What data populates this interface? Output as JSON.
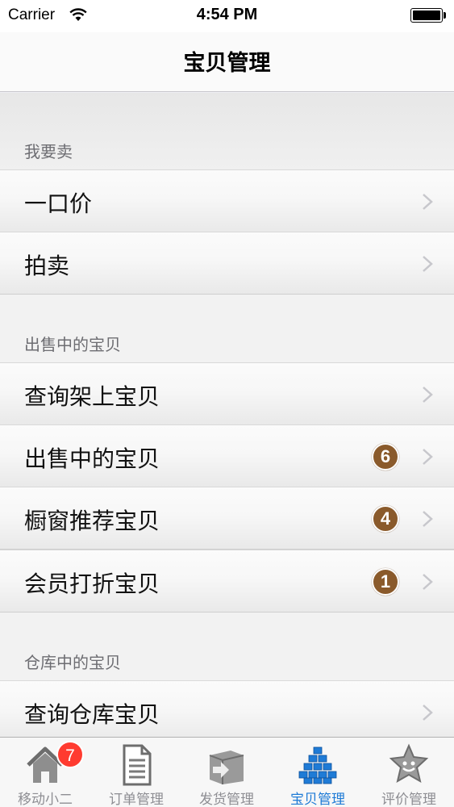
{
  "status_bar": {
    "carrier": "Carrier",
    "time": "4:54 PM",
    "wifi_icon": "wifi-icon",
    "battery_icon": "battery-icon"
  },
  "nav": {
    "title": "宝贝管理"
  },
  "sections": [
    {
      "header": "我要卖",
      "rows": [
        {
          "label": "一口价"
        },
        {
          "label": "拍卖"
        }
      ]
    },
    {
      "header": "出售中的宝贝",
      "rows": [
        {
          "label": "查询架上宝贝"
        },
        {
          "label": "出售中的宝贝",
          "badge": "6"
        },
        {
          "label": "橱窗推荐宝贝",
          "badge": "4"
        },
        {
          "label": "会员打折宝贝",
          "badge": "1"
        }
      ]
    },
    {
      "header": "仓库中的宝贝",
      "rows": [
        {
          "label": "查询仓库宝贝"
        }
      ]
    }
  ],
  "tabs": [
    {
      "label": "移动小二",
      "icon": "home-icon",
      "badge": "7"
    },
    {
      "label": "订单管理",
      "icon": "document-icon"
    },
    {
      "label": "发货管理",
      "icon": "shipping-box-icon"
    },
    {
      "label": "宝贝管理",
      "icon": "blocks-icon",
      "active": true
    },
    {
      "label": "评价管理",
      "icon": "rating-star-icon"
    }
  ],
  "colors": {
    "badge": "#8a5a2b",
    "tab_active": "#1f7bd6",
    "tab_badge": "#ff3b30"
  }
}
